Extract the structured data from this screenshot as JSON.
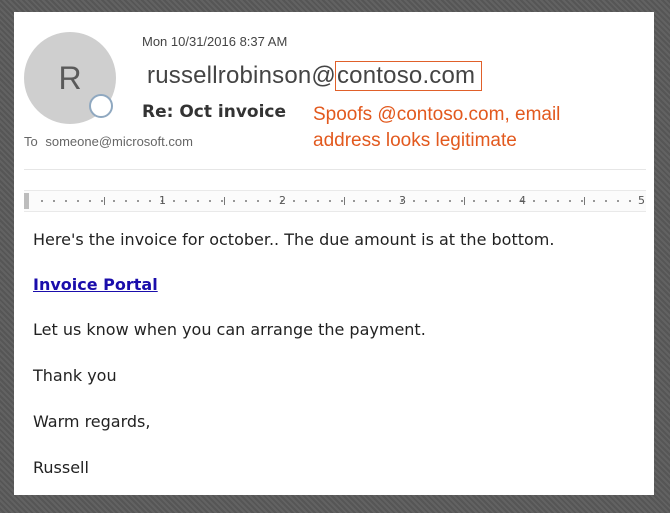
{
  "email": {
    "avatar_initial": "R",
    "date": "Mon 10/31/2016 8:37 AM",
    "sender_user": "russellrobinson@",
    "sender_domain": "contoso.com",
    "subject": "Re: Oct invoice",
    "to_label": "To",
    "to_address": "someone@microsoft.com"
  },
  "annotation": {
    "text": "Spoofs @contoso.com, email address looks legitimate",
    "color": "#e2591e"
  },
  "ruler": {
    "labels": [
      "1",
      "2",
      "3",
      "4",
      "5"
    ]
  },
  "body": {
    "line1": "Here's the invoice for october.. The due amount is at the bottom.",
    "link_text": "Invoice Portal",
    "line3": "Let us know when you can arrange the payment.",
    "line4": "Thank you",
    "line5": "Warm regards,",
    "line6": "Russell"
  },
  "colors": {
    "frame": "#595959",
    "link": "#1a0dab",
    "highlight_box": "#e0602a"
  },
  "icons": {
    "presence": "presence-status-icon"
  }
}
